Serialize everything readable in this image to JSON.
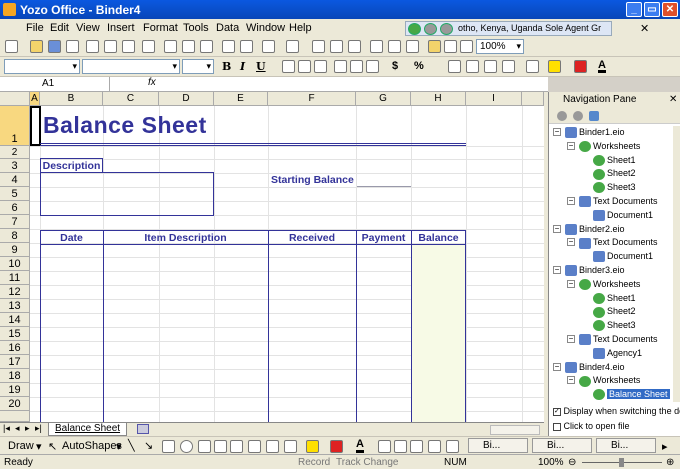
{
  "app": {
    "title": "Yozo Office - Binder4"
  },
  "menu": [
    "File",
    "Edit",
    "View",
    "Insert",
    "Format",
    "Tools",
    "Data",
    "Window",
    "Help"
  ],
  "ad": {
    "text": "otho, Kenya, Uganda Sole Agent    Gr"
  },
  "toolbar": {
    "zoom": "100%"
  },
  "formula": {
    "cell": "A1",
    "fx": "fx"
  },
  "sheet": {
    "columns": [
      "A",
      "B",
      "C",
      "D",
      "E",
      "F",
      "G",
      "H",
      "I"
    ],
    "rows": [
      "1",
      "2",
      "3",
      "4",
      "5",
      "6",
      "7",
      "8",
      "9",
      "10",
      "11",
      "12",
      "13",
      "14",
      "15",
      "16",
      "17",
      "18",
      "19",
      "20"
    ],
    "title": "Balance Sheet",
    "description_label": "Description",
    "starting_balance_label": "Starting Balance",
    "table_headers": [
      "Date",
      "Item Description",
      "Received",
      "Payment",
      "Balance"
    ]
  },
  "tabs": {
    "active": "Balance Sheet"
  },
  "nav": {
    "title": "Navigation Pane",
    "tree": [
      {
        "label": "Binder1.eio",
        "level": 0,
        "type": "binder"
      },
      {
        "label": "Worksheets",
        "level": 1,
        "type": "ws"
      },
      {
        "label": "Sheet1",
        "level": 2,
        "type": "sheet"
      },
      {
        "label": "Sheet2",
        "level": 2,
        "type": "sheet"
      },
      {
        "label": "Sheet3",
        "level": 2,
        "type": "sheet"
      },
      {
        "label": "Text Documents",
        "level": 1,
        "type": "td"
      },
      {
        "label": "Document1",
        "level": 2,
        "type": "doc"
      },
      {
        "label": "Binder2.eio",
        "level": 0,
        "type": "binder"
      },
      {
        "label": "Text Documents",
        "level": 1,
        "type": "td"
      },
      {
        "label": "Document1",
        "level": 2,
        "type": "doc"
      },
      {
        "label": "Binder3.eio",
        "level": 0,
        "type": "binder"
      },
      {
        "label": "Worksheets",
        "level": 1,
        "type": "ws"
      },
      {
        "label": "Sheet1",
        "level": 2,
        "type": "sheet"
      },
      {
        "label": "Sheet2",
        "level": 2,
        "type": "sheet"
      },
      {
        "label": "Sheet3",
        "level": 2,
        "type": "sheet"
      },
      {
        "label": "Text Documents",
        "level": 1,
        "type": "td"
      },
      {
        "label": "Agency1",
        "level": 2,
        "type": "doc"
      },
      {
        "label": "Binder4.eio",
        "level": 0,
        "type": "binder"
      },
      {
        "label": "Worksheets",
        "level": 1,
        "type": "ws"
      },
      {
        "label": "Balance Sheet",
        "level": 2,
        "type": "sheet",
        "selected": true
      }
    ],
    "opt1": "Display when switching the do",
    "opt2": "Click to open file"
  },
  "draw": {
    "draw": "Draw",
    "autoshapes": "AutoShapes",
    "task1": "Bi...",
    "task2": "Bi...",
    "task3": "Bi..."
  },
  "status": {
    "ready": "Ready",
    "record": "Record",
    "track": "Track Change",
    "num": "NUM",
    "zoom": "100%"
  }
}
